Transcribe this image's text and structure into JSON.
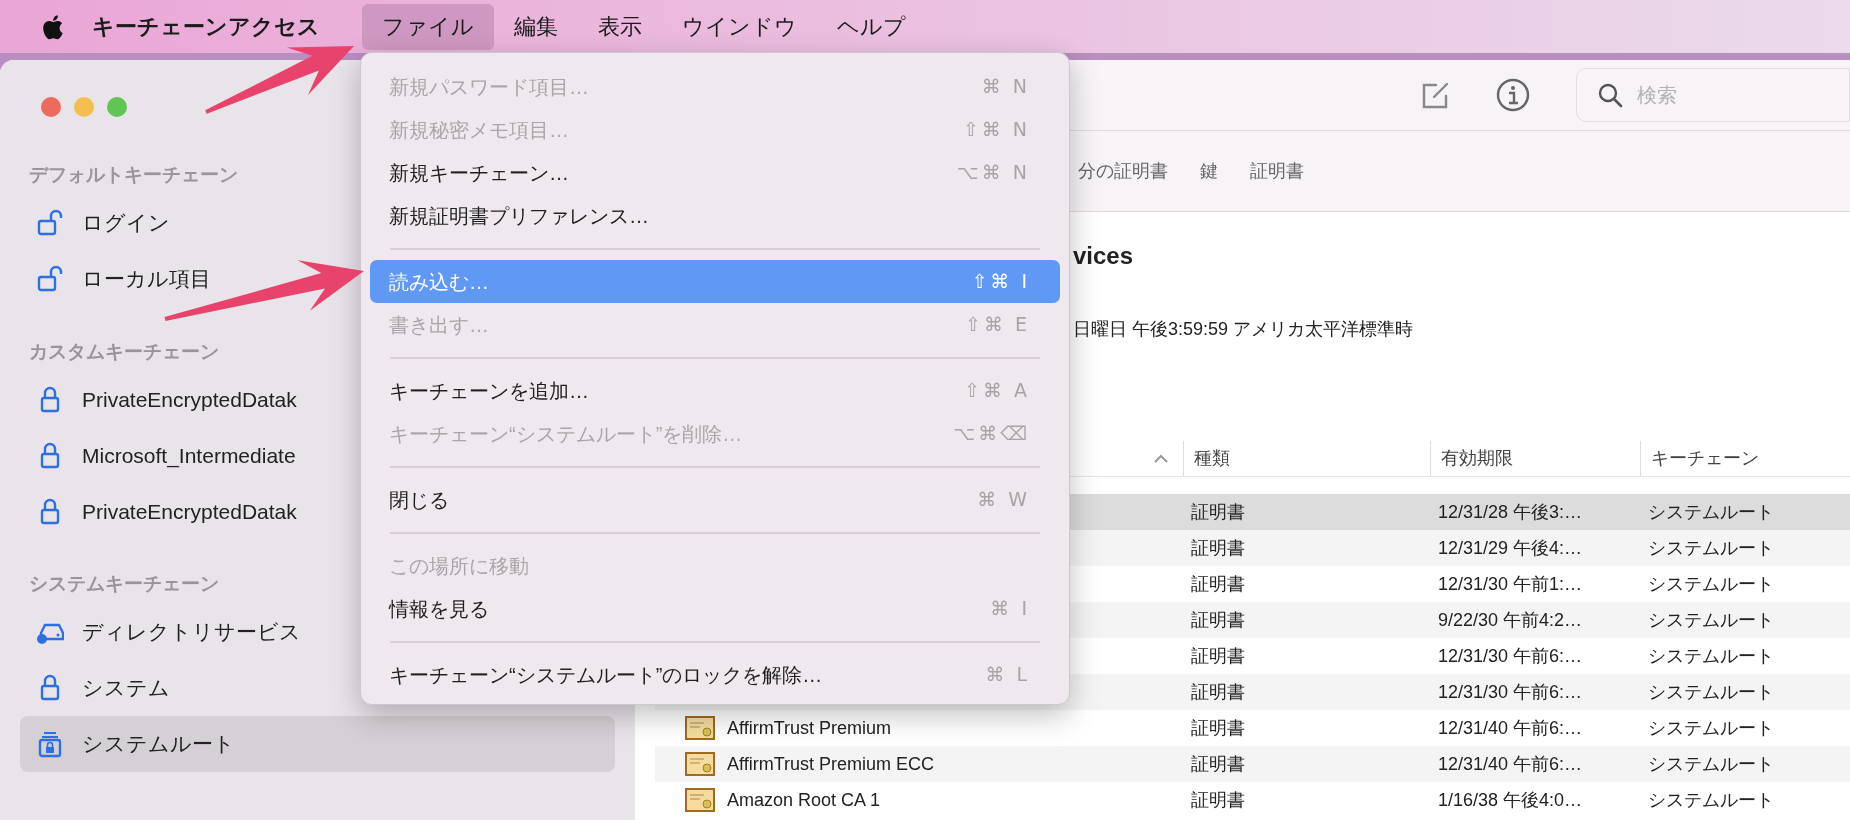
{
  "menu_bar": {
    "app_name": "キーチェーンアクセス",
    "menus": [
      {
        "label": "ファイル",
        "selected": true
      },
      {
        "label": "編集",
        "selected": false
      },
      {
        "label": "表示",
        "selected": false
      },
      {
        "label": "ウインドウ",
        "selected": false
      },
      {
        "label": "ヘルプ",
        "selected": false
      }
    ]
  },
  "sidebar": {
    "sections": [
      {
        "title": "デフォルトキーチェーン",
        "items": [
          {
            "label": "ログイン",
            "kind": "unlocked",
            "selected": false
          },
          {
            "label": "ローカル項目",
            "kind": "unlocked",
            "selected": false
          }
        ]
      },
      {
        "title": "カスタムキーチェーン",
        "items": [
          {
            "label": "PrivateEncryptedDatak",
            "kind": "locked",
            "selected": false
          },
          {
            "label": "Microsoft_Intermediate",
            "kind": "locked",
            "selected": false
          },
          {
            "label": "PrivateEncryptedDatak",
            "kind": "locked",
            "selected": false
          }
        ]
      },
      {
        "title": "システムキーチェーン",
        "items": [
          {
            "label": "ディレクトリサービス",
            "kind": "directory",
            "selected": false
          },
          {
            "label": "システム",
            "kind": "locked",
            "selected": false
          },
          {
            "label": "システムルート",
            "kind": "root",
            "selected": true
          }
        ]
      }
    ]
  },
  "toolbar": {
    "search": {
      "placeholder": "検索"
    }
  },
  "tabs": [
    {
      "label": "分の証明書",
      "selected": false
    },
    {
      "label": "鍵",
      "selected": false
    },
    {
      "label": "証明書",
      "selected": false
    }
  ],
  "details": {
    "title": "vices",
    "expiry": "日曜日 午後3:59:59 アメリカ太平洋標準時"
  },
  "table": {
    "columns": [
      {
        "sorted": true
      },
      {
        "label": "種類",
        "sorted": false
      },
      {
        "label": "有効期限",
        "sorted": false
      },
      {
        "label": "キーチェーン",
        "sorted": false
      }
    ],
    "rows": [
      {
        "type": "証明書",
        "expires": "12/31/28 午後3:…",
        "keychain": "システムルート",
        "selected": true
      },
      {
        "type": "証明書",
        "expires": "12/31/29 午後4:…",
        "keychain": "システムルート",
        "selected": false
      },
      {
        "type": "証明書",
        "expires": "12/31/30 午前1:…",
        "keychain": "システムルート",
        "selected": false
      },
      {
        "type": "証明書",
        "expires": "9/22/30 午前4:2…",
        "keychain": "システムルート",
        "selected": false
      },
      {
        "type": "証明書",
        "expires": "12/31/30 午前6:…",
        "keychain": "システムルート",
        "selected": false
      },
      {
        "type": "証明書",
        "expires": "12/31/30 午前6:…",
        "keychain": "システムルート",
        "selected": false
      },
      {
        "name": "AffirmTrust Premium",
        "type": "証明書",
        "expires": "12/31/40 午前6:…",
        "keychain": "システムルート",
        "selected": false
      },
      {
        "name": "AffirmTrust Premium ECC",
        "type": "証明書",
        "expires": "12/31/40 午前6:…",
        "keychain": "システムルート",
        "selected": false
      },
      {
        "name": "Amazon Root CA 1",
        "type": "証明書",
        "expires": "1/16/38 午後4:0…",
        "keychain": "システムルート",
        "selected": false
      }
    ]
  },
  "file_menu": {
    "items": [
      {
        "kind": "item",
        "label": "新規パスワード項目…",
        "shortcut": "⌘ N",
        "disabled": true,
        "selected": false
      },
      {
        "kind": "item",
        "label": "新規秘密メモ項目…",
        "shortcut": "⇧⌘ N",
        "disabled": true,
        "selected": false
      },
      {
        "kind": "item",
        "label": "新規キーチェーン…",
        "shortcut": "⌥⌘ N",
        "disabled": false,
        "selected": false
      },
      {
        "kind": "item",
        "label": "新規証明書プリファレンス…",
        "disabled": false,
        "selected": false
      },
      {
        "kind": "separator"
      },
      {
        "kind": "item",
        "label": "読み込む…",
        "shortcut": "⇧⌘ I",
        "disabled": false,
        "selected": true
      },
      {
        "kind": "item",
        "label": "書き出す…",
        "shortcut": "⇧⌘ E",
        "disabled": true,
        "selected": false
      },
      {
        "kind": "separator"
      },
      {
        "kind": "item",
        "label": "キーチェーンを追加…",
        "shortcut": "⇧⌘ A",
        "disabled": false,
        "selected": false
      },
      {
        "kind": "item",
        "label": "キーチェーン“システムルート”を削除…",
        "shortcut": "⌥⌘⌫",
        "disabled": true,
        "selected": false
      },
      {
        "kind": "separator"
      },
      {
        "kind": "item",
        "label": "閉じる",
        "shortcut": "⌘ W",
        "disabled": false,
        "selected": false
      },
      {
        "kind": "separator"
      },
      {
        "kind": "item",
        "label": "この場所に移動",
        "disabled": true,
        "selected": false
      },
      {
        "kind": "item",
        "label": "情報を見る",
        "shortcut": "⌘ I",
        "disabled": false,
        "selected": false
      },
      {
        "kind": "separator"
      },
      {
        "kind": "item",
        "label": "キーチェーン“システムルート”のロックを解除…",
        "shortcut": "⌘ L",
        "disabled": false,
        "selected": false
      }
    ]
  }
}
